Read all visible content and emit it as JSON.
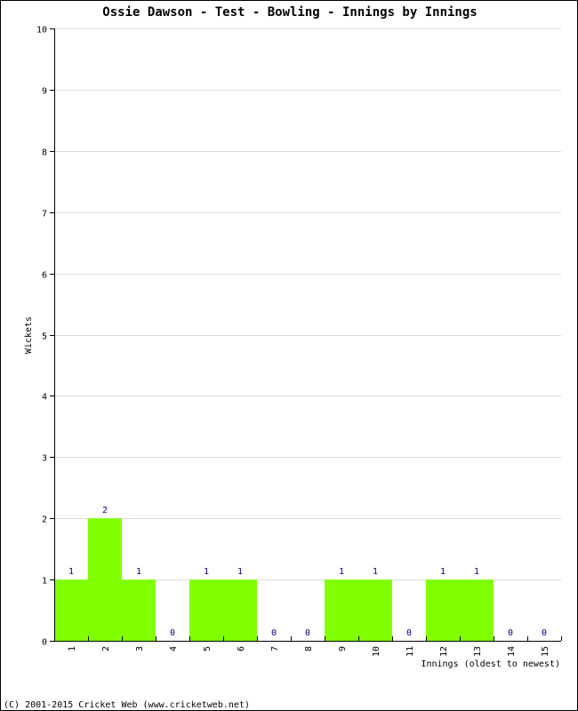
{
  "chart_data": {
    "type": "bar",
    "title": "Ossie Dawson - Test - Bowling - Innings by Innings",
    "xlabel": "Innings (oldest to newest)",
    "ylabel": "Wickets",
    "categories": [
      "1",
      "2",
      "3",
      "4",
      "5",
      "6",
      "7",
      "8",
      "9",
      "10",
      "11",
      "12",
      "13",
      "14",
      "15"
    ],
    "values": [
      1,
      2,
      1,
      0,
      1,
      1,
      0,
      0,
      1,
      1,
      0,
      1,
      1,
      0,
      0
    ],
    "ylim": [
      0,
      10
    ],
    "yticks": [
      0,
      1,
      2,
      3,
      4,
      5,
      6,
      7,
      8,
      9,
      10
    ],
    "grid": true,
    "bar_color": "#80ff00",
    "value_label_color": "#000080"
  },
  "footer": "(C) 2001-2015 Cricket Web (www.cricketweb.net)"
}
